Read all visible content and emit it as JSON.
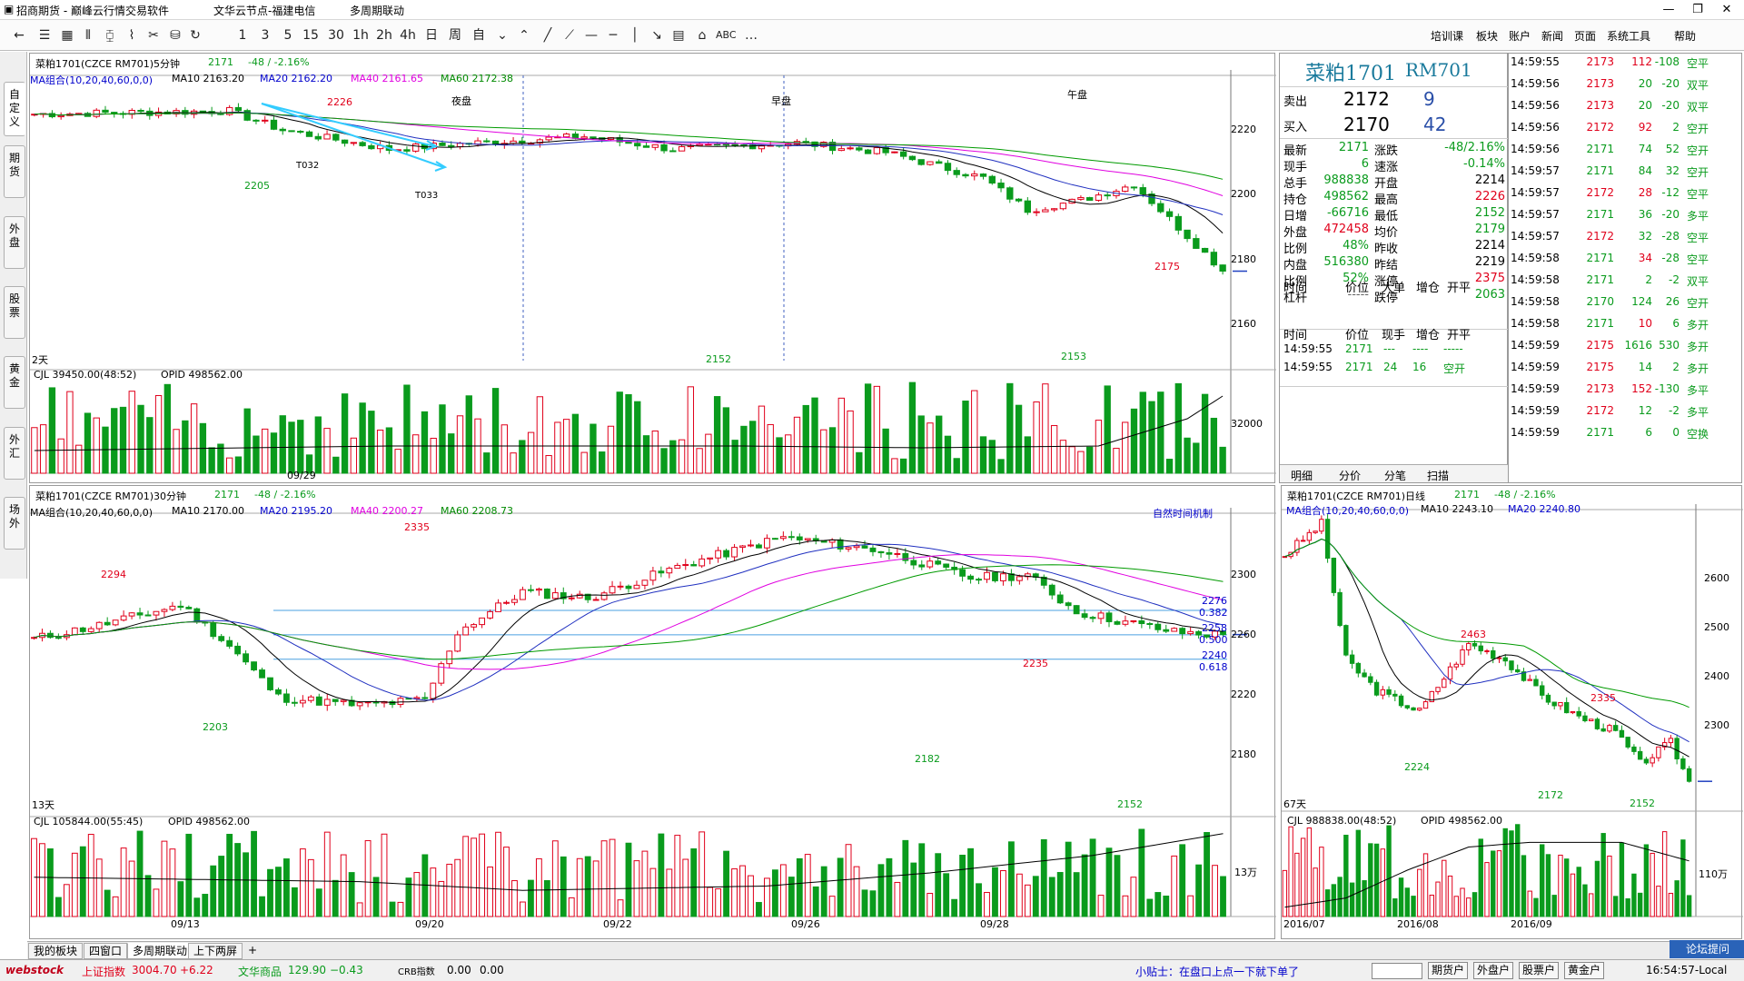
{
  "window": {
    "title": "招商期货 - 巅峰云行情交易软件",
    "server": "文华云节点-福建电信",
    "mode": "多周期联动"
  },
  "toolbar": {
    "icons": [
      "back-icon",
      "list-icon",
      "grid-icon",
      "bar-chart-icon",
      "candle-chart-icon",
      "line-chart-icon",
      "tools-icon",
      "dashboard-icon",
      "save-icon",
      "refresh-icon"
    ],
    "periods": [
      "1",
      "3",
      "5",
      "15",
      "30",
      "1h",
      "2h",
      "4h",
      "日",
      "周",
      "自"
    ],
    "menus": [
      "培训课",
      "板块",
      "账户",
      "新闻",
      "页面",
      "系统工具",
      "帮助"
    ]
  },
  "left_tabs": [
    "自定义",
    "期货",
    "外盘",
    "股票",
    "黄金",
    "外汇",
    "场外"
  ],
  "chart5m": {
    "title": "菜粕1701(CZCE RM701)5分钟",
    "price": "2171",
    "change": "-48 / -2.16%",
    "ma_label": "MA组合(10,20,40,60,0,0)",
    "ma10": "MA10 2163.20",
    "ma20": "MA20 2162.20",
    "ma40": "MA40 2161.65",
    "ma60": "MA60 2172.38",
    "sessions": [
      "夜盘",
      "早盘",
      "午盘"
    ],
    "yticks": [
      "2220",
      "2200",
      "2180",
      "2160"
    ],
    "days": "2天",
    "date": "09/29",
    "ann": {
      "hi": "2226",
      "lo1": "2205",
      "t1": "T032",
      "t2": "T033",
      "lo2": "2152",
      "lo3": "2153",
      "last": "2175"
    },
    "vol_label": "CJL 39450.00(48:52)",
    "opi": "OPID 498562.00",
    "vol_tick": "32000"
  },
  "chart30m": {
    "title": "菜粕1701(CZCE RM701)30分钟",
    "price": "2171",
    "change": "-48 / -2.16%",
    "ma_label": "MA组合(10,20,40,60,0,0)",
    "ma10": "MA10 2170.00",
    "ma20": "MA20 2195.20",
    "ma40": "MA40 2200.27",
    "ma60": "MA60 2208.73",
    "mech": "自然时间机制",
    "yticks": [
      "2300",
      "2260",
      "2220",
      "2180"
    ],
    "fib": [
      [
        "2276",
        "0.382"
      ],
      [
        "2258",
        "0.500"
      ],
      [
        "2240",
        "0.618"
      ]
    ],
    "ann": {
      "a": "2294",
      "b": "2335",
      "c": "2203",
      "d": "2235",
      "e": "2182",
      "f": "2152"
    },
    "days": "13天",
    "vol_label": "CJL 105844.00(55:45)",
    "opi": "OPID 498562.00",
    "vol_tick": "13万",
    "dates": [
      "09/13",
      "09/20",
      "09/22",
      "09/26",
      "09/28"
    ]
  },
  "chartD": {
    "title": "菜粕1701(CZCE RM701)日线",
    "price": "2171",
    "change": "-48 / -2.16%",
    "ma_label": "MA组合(10,20,40,60,0,0)",
    "ma10": "MA10 2243.10",
    "ma20": "MA20 2240.80",
    "yticks": [
      "2600",
      "2500",
      "2400",
      "2300"
    ],
    "ann": {
      "a": "2463",
      "b": "2335",
      "c": "2224",
      "d": "2172",
      "e": "2152"
    },
    "days": "67天",
    "vol_label": "CJL 988838.00(48:52)",
    "opi": "OPID 498562.00",
    "vol_tick": "110万",
    "dates": [
      "2016/07",
      "2016/08",
      "2016/09"
    ]
  },
  "quote": {
    "name": "菜粕1701",
    "code": "RM701",
    "sell": {
      "label": "卖出",
      "price": "2172",
      "vol": "9"
    },
    "buy": {
      "label": "买入",
      "price": "2170",
      "vol": "42"
    },
    "left": [
      [
        "最新",
        "2171"
      ],
      [
        "现手",
        "6"
      ],
      [
        "总手",
        "988838"
      ],
      [
        "持仓",
        "498562"
      ],
      [
        "日增",
        "-66716"
      ],
      [
        "外盘",
        "472458"
      ],
      [
        "比例",
        "48%"
      ],
      [
        "内盘",
        "516380"
      ],
      [
        "比例",
        "52%"
      ],
      [
        "杠杆",
        "-----"
      ]
    ],
    "right": [
      [
        "涨跌",
        "-48/2.16%"
      ],
      [
        "速涨",
        "-0.14%"
      ],
      [
        "开盘",
        "2214"
      ],
      [
        "最高",
        "2226"
      ],
      [
        "最低",
        "2152"
      ],
      [
        "均价",
        "2179"
      ],
      [
        "昨收",
        "2214"
      ],
      [
        "昨结",
        "2219"
      ],
      [
        "涨停",
        "2375"
      ],
      [
        "跌停",
        "2063"
      ]
    ],
    "hdr1": [
      "时间",
      "价位",
      "大单",
      "增仓",
      "开平"
    ],
    "hdr2": [
      "时间",
      "价位",
      "现手",
      "增仓",
      "开平"
    ],
    "detail": [
      [
        "14:59:55",
        "2171",
        "---",
        "----",
        "-----"
      ],
      [
        "14:59:55",
        "2171",
        "24",
        "16",
        "空开"
      ]
    ],
    "tabs": [
      "明细",
      "分价",
      "分笔",
      "扫描"
    ]
  },
  "trades": [
    [
      "14:59:55",
      "2173",
      "112",
      "-108",
      "空平"
    ],
    [
      "14:59:56",
      "2173",
      "20",
      "-20",
      "双平"
    ],
    [
      "14:59:56",
      "2173",
      "20",
      "-20",
      "双平"
    ],
    [
      "14:59:56",
      "2172",
      "92",
      "2",
      "空开"
    ],
    [
      "14:59:56",
      "2171",
      "74",
      "52",
      "空开"
    ],
    [
      "14:59:57",
      "2171",
      "84",
      "32",
      "空开"
    ],
    [
      "14:59:57",
      "2172",
      "28",
      "-12",
      "空平"
    ],
    [
      "14:59:57",
      "2171",
      "36",
      "-20",
      "多平"
    ],
    [
      "14:59:57",
      "2172",
      "32",
      "-28",
      "空平"
    ],
    [
      "14:59:58",
      "2171",
      "34",
      "-28",
      "空平"
    ],
    [
      "14:59:58",
      "2171",
      "2",
      "-2",
      "双平"
    ],
    [
      "14:59:58",
      "2170",
      "124",
      "26",
      "空开"
    ],
    [
      "14:59:58",
      "2171",
      "10",
      "6",
      "多开"
    ],
    [
      "14:59:59",
      "2175",
      "1616",
      "530",
      "多开"
    ],
    [
      "14:59:59",
      "2175",
      "14",
      "2",
      "多开"
    ],
    [
      "14:59:59",
      "2173",
      "152",
      "-130",
      "多平"
    ],
    [
      "14:59:59",
      "2172",
      "12",
      "-2",
      "多平"
    ],
    [
      "14:59:59",
      "2171",
      "6",
      "0",
      "空换"
    ]
  ],
  "bottom_tabs": [
    "我的板块",
    "四窗口",
    "多周期联动",
    "上下两屏",
    "+"
  ],
  "status": {
    "logo": "webstock",
    "idx1": "上证指数",
    "idx1v": "3004.70",
    "idx1c": "+6.22",
    "idx2": "文华商品",
    "idx2v": "129.90",
    "idx2c": "−0.43",
    "idx3": "CRB指数",
    "idx3v": "0.00",
    "idx3c": "0.00",
    "tip": "小贴士：在盘口上点一下就下单了",
    "btns": [
      "期货户",
      "外盘户",
      "股票户",
      "黄金户"
    ],
    "forum": "论坛提问",
    "time": "16:54:57-Local"
  }
}
